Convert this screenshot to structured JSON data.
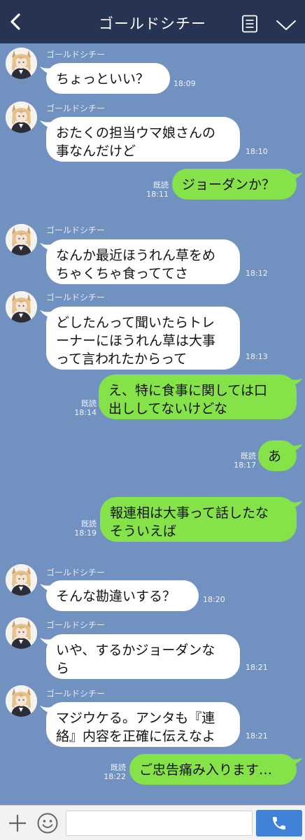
{
  "header": {
    "title": "ゴールドシチー",
    "back_icon": "chevron-left-icon",
    "memo_icon": "note-icon",
    "down_icon": "chevron-down-icon"
  },
  "colors": {
    "header_bg": "#263352",
    "chat_bg": "#7192c1",
    "incoming_bubble": "#ffffff",
    "outgoing_bubble": "#85e249",
    "call_button": "#3f82d8"
  },
  "messages": [
    {
      "direction": "in",
      "sender": "ゴールドシチー",
      "lines": [
        "ちょっといい？"
      ],
      "time": "18:09"
    },
    {
      "direction": "in",
      "sender": "ゴールドシチー",
      "lines": [
        "おたくの担当ウマ娘さんの",
        "事なんだけど"
      ],
      "time": "18:10"
    },
    {
      "direction": "out",
      "read": "既読",
      "lines": [
        "ジョーダンか？"
      ],
      "time": "18:11"
    },
    {
      "direction": "in",
      "sender": "ゴールドシチー",
      "lines": [
        "なんか最近ほうれん草をめ",
        "ちゃくちゃ食っててさ"
      ],
      "time": "18:12"
    },
    {
      "direction": "in",
      "sender": "ゴールドシチー",
      "lines": [
        "どしたんって聞いたらトレ",
        "ーナーにほうれん草は大事",
        "って言われたからって"
      ],
      "time": "18:13"
    },
    {
      "direction": "out",
      "read": "既読",
      "lines": [
        "え、特に食事に関しては口",
        "出ししてないけどな"
      ],
      "time": "18:14"
    },
    {
      "direction": "out",
      "read": "既読",
      "lines": [
        "あ"
      ],
      "time": "18:17"
    },
    {
      "direction": "out",
      "read": "既読",
      "lines": [
        "報連相は大事って話したな",
        "そういえば"
      ],
      "time": "18:19"
    },
    {
      "direction": "in",
      "sender": "ゴールドシチー",
      "lines": [
        "そんな勘違いする？"
      ],
      "time": "18:20"
    },
    {
      "direction": "in",
      "sender": "ゴールドシチー",
      "lines": [
        "いや、するかジョーダンな",
        "ら"
      ],
      "time": "18:21"
    },
    {
      "direction": "in",
      "sender": "ゴールドシチー",
      "lines": [
        "マジウケる。アンタも『連",
        "絡』内容を正確に伝えなよ"
      ],
      "time": "18:21"
    },
    {
      "direction": "out",
      "read": "既読",
      "lines": [
        "ご忠告痛み入ります…"
      ],
      "time": "18:22"
    }
  ],
  "input_bar": {
    "plus_icon": "plus-icon",
    "emoji_icon": "smiley-icon",
    "message_value": "",
    "message_placeholder": "",
    "call_icon": "phone-icon"
  }
}
